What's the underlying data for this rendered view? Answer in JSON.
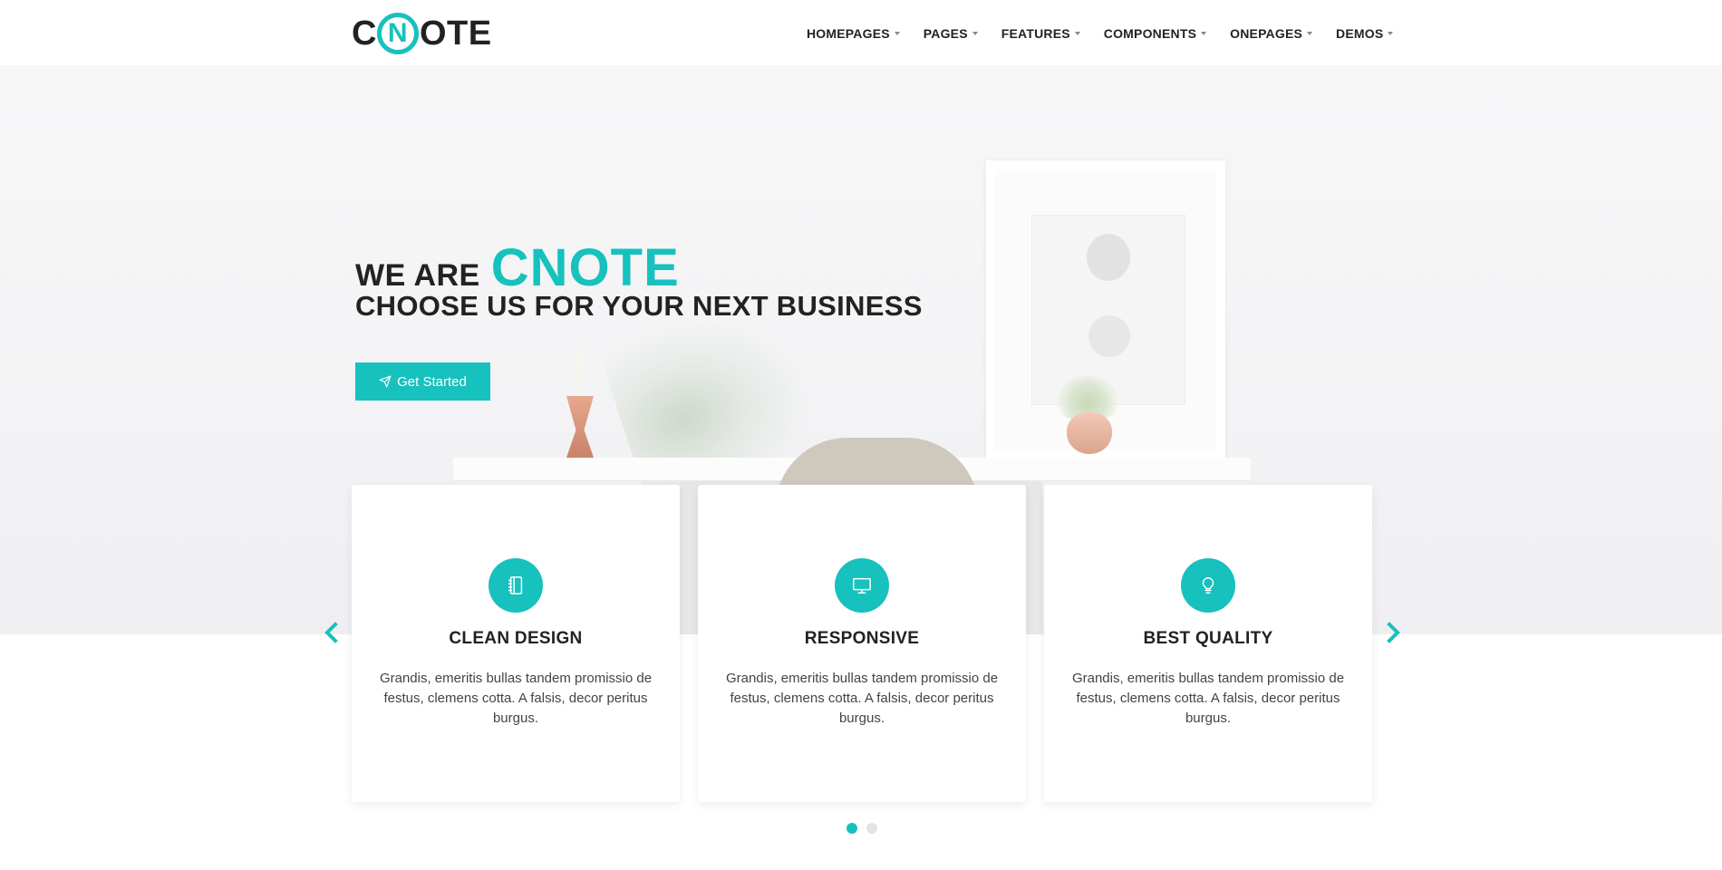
{
  "brand": {
    "logo_c": "C",
    "logo_n": "N",
    "logo_rest": "OTE",
    "accent_color": "#17c1bd"
  },
  "nav": {
    "items": [
      {
        "label": "HOMEPAGES"
      },
      {
        "label": "PAGES"
      },
      {
        "label": "FEATURES"
      },
      {
        "label": "COMPONENTS"
      },
      {
        "label": "ONEPAGES"
      },
      {
        "label": "DEMOS"
      }
    ]
  },
  "hero": {
    "lead": "WE ARE",
    "brand": "CNOTE",
    "subtitle": "CHOOSE US FOR YOUR NEXT BUSINESS",
    "button_label": "Get Started",
    "button_icon": "paper-plane-icon"
  },
  "cards": [
    {
      "icon": "notebook-icon",
      "title": "CLEAN DESIGN",
      "text": "Grandis, emeritis bullas tandem promissio de festus, clemens cotta. A falsis, decor peritus burgus."
    },
    {
      "icon": "monitor-icon",
      "title": "RESPONSIVE",
      "text": "Grandis, emeritis bullas tandem promissio de festus, clemens cotta. A falsis, decor peritus burgus."
    },
    {
      "icon": "lightbulb-icon",
      "title": "BEST QUALITY",
      "text": "Grandis, emeritis bullas tandem promissio de festus, clemens cotta. A falsis, decor peritus burgus."
    }
  ],
  "carousel": {
    "prev_icon": "chevron-left-icon",
    "next_icon": "chevron-right-icon",
    "page_count": 2,
    "active_page": 1
  }
}
